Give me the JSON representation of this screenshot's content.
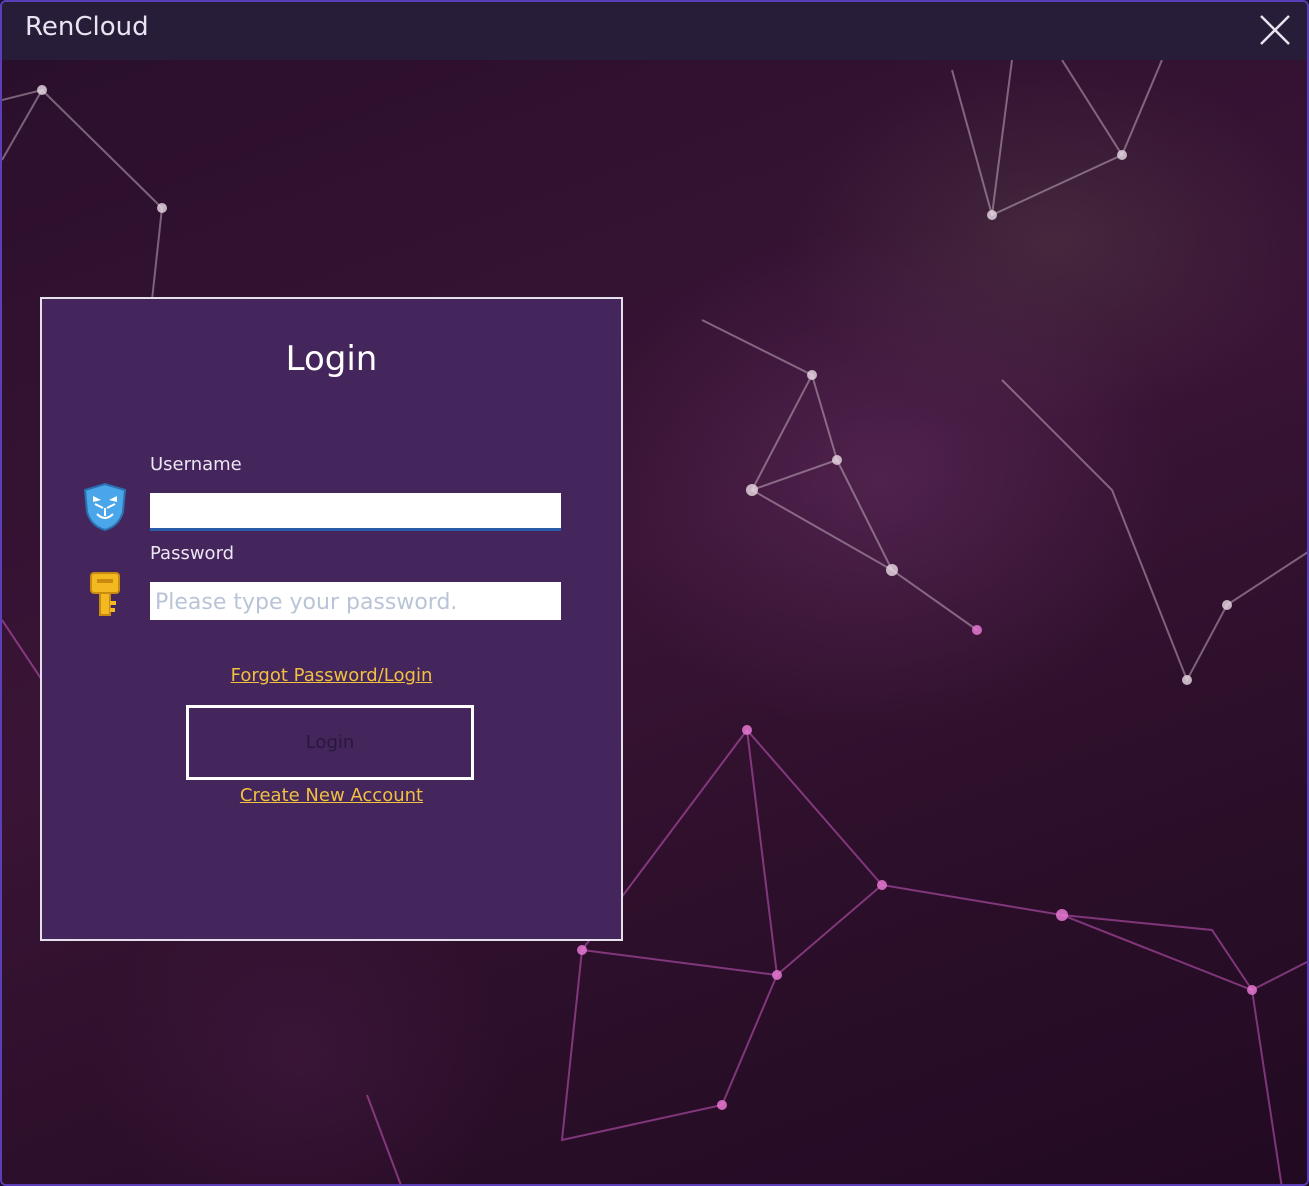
{
  "window": {
    "title": "RenCloud",
    "close_icon": "close-icon"
  },
  "login": {
    "heading": "Login",
    "username_label": "Username",
    "username_value": "",
    "username_icon": "mask-shield-icon",
    "password_label": "Password",
    "password_placeholder": "Please type your password.",
    "password_icon": "key-icon",
    "forgot_link": "Forgot Password/Login",
    "login_button": "Login",
    "create_link": "Create New Account"
  },
  "colors": {
    "panel_bg": "#44255c",
    "link": "#f0c040",
    "titlebar": "#281d38",
    "window_border": "#5b3fb8"
  }
}
